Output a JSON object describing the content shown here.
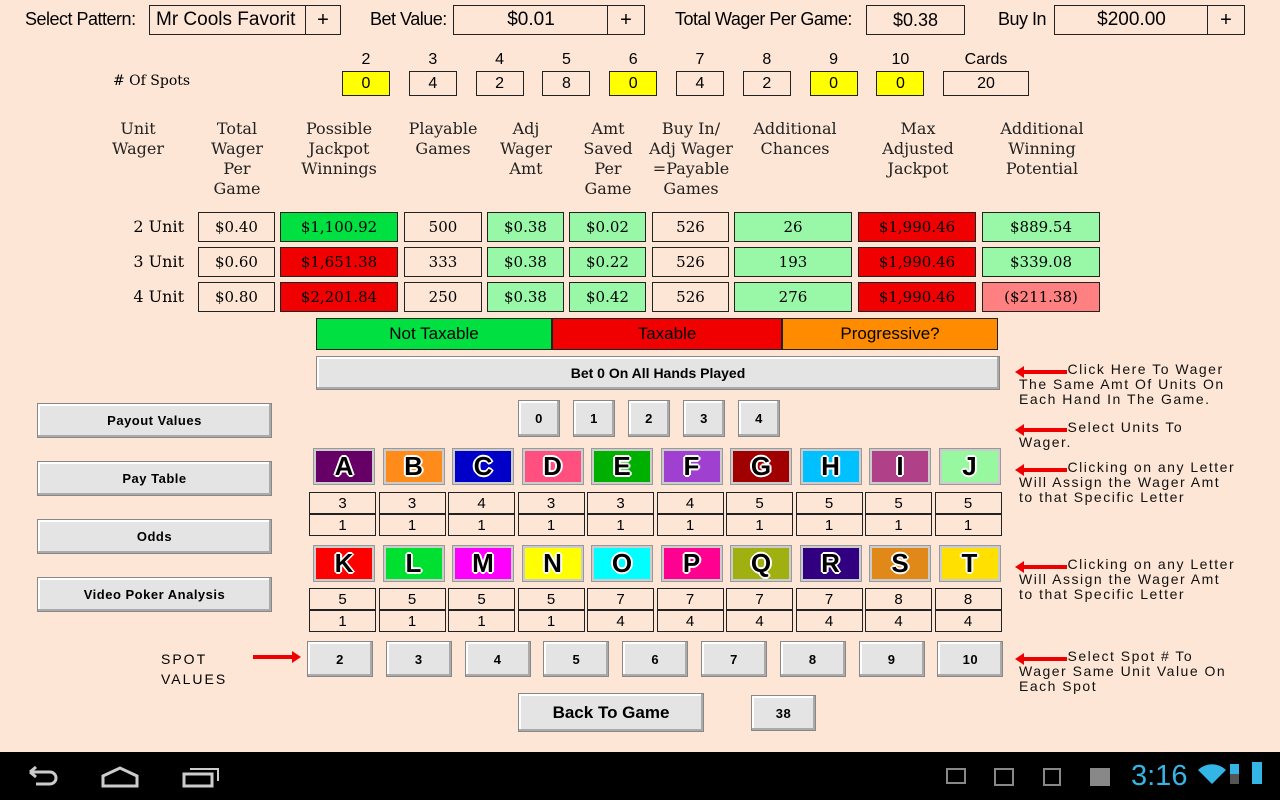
{
  "top": {
    "pattern_label": "Select Pattern:",
    "pattern_value": "Mr Cools Favorit",
    "plus": "+",
    "bet_label": "Bet Value:",
    "bet_value": "$0.01",
    "total_label": "Total Wager Per Game:",
    "total_value": "$0.38",
    "buyin_label": "Buy In",
    "buyin_value": "$200.00"
  },
  "spots": {
    "label": "# Of Spots",
    "headers": [
      "2",
      "3",
      "4",
      "5",
      "6",
      "7",
      "8",
      "9",
      "10"
    ],
    "values": [
      "0",
      "4",
      "2",
      "8",
      "0",
      "4",
      "2",
      "0",
      "0"
    ],
    "highlight": [
      true,
      false,
      false,
      false,
      true,
      false,
      false,
      true,
      true
    ],
    "cards_label": "Cards",
    "cards_value": "20"
  },
  "table": {
    "headers": [
      "Unit\nWager",
      "Total\nWager\nPer\nGame",
      "Possible\nJackpot\nWinnings",
      "Playable\nGames",
      "Adj\nWager\nAmt",
      "Amt\nSaved\nPer\nGame",
      "Buy In/\nAdj Wager\n=Payable\nGames",
      "Additional\nChances",
      "Max\nAdjusted\nJackpot",
      "Additional\nWinning\nPotential"
    ],
    "rows": [
      {
        "label": "2 Unit",
        "cells": [
          "$0.40",
          "$1,100.92",
          "500",
          "$0.38",
          "$0.02",
          "526",
          "26",
          "$1,990.46",
          "$889.54"
        ],
        "colors": [
          "",
          "#00e040",
          "",
          "#98f8a8",
          "#98f8a8",
          "",
          "#98f8a8",
          "#f00000",
          "#98f8a8"
        ]
      },
      {
        "label": "3 Unit",
        "cells": [
          "$0.60",
          "$1,651.38",
          "333",
          "$0.38",
          "$0.22",
          "526",
          "193",
          "$1,990.46",
          "$339.08"
        ],
        "colors": [
          "",
          "#f00000",
          "",
          "#98f8a8",
          "#98f8a8",
          "",
          "#98f8a8",
          "#f00000",
          "#98f8a8"
        ]
      },
      {
        "label": "4 Unit",
        "cells": [
          "$0.80",
          "$2,201.84",
          "250",
          "$0.38",
          "$0.42",
          "526",
          "276",
          "$1,990.46",
          "($211.38)"
        ],
        "colors": [
          "",
          "#f00000",
          "",
          "#98f8a8",
          "#98f8a8",
          "",
          "#98f8a8",
          "#f00000",
          "#ff8080"
        ]
      }
    ]
  },
  "legend": [
    {
      "label": "Not Taxable",
      "color": "#00e040"
    },
    {
      "label": "Taxable",
      "color": "#f00000"
    },
    {
      "label": "Progressive?",
      "color": "#ff8c00"
    }
  ],
  "bet_all": "Bet 0 On All Hands Played",
  "units": [
    "0",
    "1",
    "2",
    "3",
    "4"
  ],
  "side_buttons": [
    "Payout Values",
    "Pay Table",
    "Odds",
    "Video Poker Analysis"
  ],
  "letters1": [
    {
      "l": "A",
      "c": "#660066",
      "v": [
        "3",
        "1"
      ]
    },
    {
      "l": "B",
      "c": "#ff8c1a",
      "v": [
        "3",
        "1"
      ]
    },
    {
      "l": "C",
      "c": "#0000c8",
      "v": [
        "4",
        "1"
      ]
    },
    {
      "l": "D",
      "c": "#ff5080",
      "v": [
        "3",
        "1"
      ]
    },
    {
      "l": "E",
      "c": "#00b000",
      "v": [
        "3",
        "1"
      ]
    },
    {
      "l": "F",
      "c": "#a040d0",
      "v": [
        "4",
        "1"
      ]
    },
    {
      "l": "G",
      "c": "#a00000",
      "v": [
        "5",
        "1"
      ]
    },
    {
      "l": "H",
      "c": "#00c0ff",
      "v": [
        "5",
        "1"
      ]
    },
    {
      "l": "I",
      "c": "#b04088",
      "v": [
        "5",
        "1"
      ]
    },
    {
      "l": "J",
      "c": "#98f8a0",
      "v": [
        "5",
        "1"
      ]
    }
  ],
  "letters2": [
    {
      "l": "K",
      "c": "#ff0000",
      "v": [
        "5",
        "1"
      ]
    },
    {
      "l": "L",
      "c": "#00e030",
      "v": [
        "5",
        "1"
      ]
    },
    {
      "l": "M",
      "c": "#ff00ff",
      "v": [
        "5",
        "1"
      ]
    },
    {
      "l": "N",
      "c": "#ffff00",
      "v": [
        "5",
        "1"
      ]
    },
    {
      "l": "O",
      "c": "#00ffff",
      "v": [
        "7",
        "4"
      ]
    },
    {
      "l": "P",
      "c": "#ff0090",
      "v": [
        "7",
        "4"
      ]
    },
    {
      "l": "Q",
      "c": "#a0b010",
      "v": [
        "7",
        "4"
      ]
    },
    {
      "l": "R",
      "c": "#300080",
      "v": [
        "7",
        "4"
      ]
    },
    {
      "l": "S",
      "c": "#e08818",
      "v": [
        "8",
        "4"
      ]
    },
    {
      "l": "T",
      "c": "#ffe000",
      "v": [
        "8",
        "4"
      ]
    }
  ],
  "spot_values": {
    "label": "SPOT\nVALUES",
    "buttons": [
      "2",
      "3",
      "4",
      "5",
      "6",
      "7",
      "8",
      "9",
      "10"
    ]
  },
  "back_button": "Back To Game",
  "count_button": "38",
  "notes": [
    "Click Here To Wager\nThe Same Amt Of Units On\nEach Hand In The Game.",
    "Select Units To\nWager.",
    "Clicking on any Letter\nWill Assign the Wager Amt\nto that Specific Letter",
    "Clicking on any Letter\nWill Assign the Wager Amt\nto that Specific Letter",
    "Select Spot # To\nWager Same Unit Value On\nEach Spot"
  ],
  "status": {
    "time": "3:16"
  }
}
